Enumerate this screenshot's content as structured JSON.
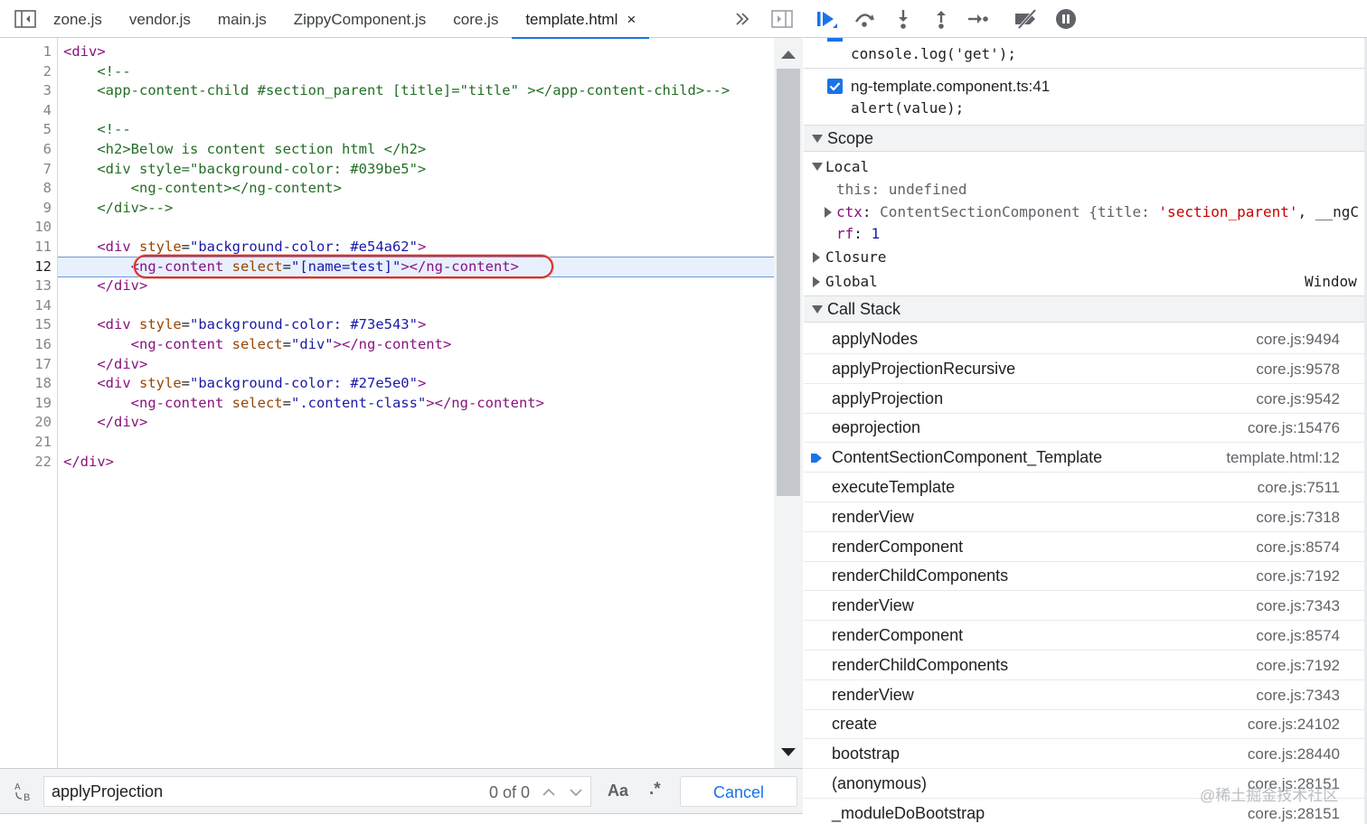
{
  "editor": {
    "tabs": [
      {
        "label": "zone.js"
      },
      {
        "label": "vendor.js"
      },
      {
        "label": "main.js"
      },
      {
        "label": "ZippyComponent.js"
      },
      {
        "label": "core.js"
      },
      {
        "label": "template.html",
        "active": true,
        "close": "×"
      }
    ],
    "overflow_icon": "chevron-double-right-icon",
    "current_line": 12,
    "lines": [
      {
        "n": "1",
        "tokens": [
          {
            "t": "<div>",
            "c": "tag"
          }
        ]
      },
      {
        "n": "2",
        "tokens": [
          {
            "t": "    <!--",
            "c": "cmt"
          }
        ]
      },
      {
        "n": "3",
        "tokens": [
          {
            "t": "    <app-content-child #section_parent [title]=\"title\" ></app-content-child>-->",
            "c": "cmt"
          }
        ]
      },
      {
        "n": "4",
        "tokens": []
      },
      {
        "n": "5",
        "tokens": [
          {
            "t": "    <!--",
            "c": "cmt"
          }
        ]
      },
      {
        "n": "6",
        "tokens": [
          {
            "t": "    <h2>Below is content section html </h2>",
            "c": "cmt"
          }
        ]
      },
      {
        "n": "7",
        "tokens": [
          {
            "t": "    <div style=\"background-color: #039be5\">",
            "c": "cmt"
          }
        ]
      },
      {
        "n": "8",
        "tokens": [
          {
            "t": "        <ng-content></ng-content>",
            "c": "cmt"
          }
        ]
      },
      {
        "n": "9",
        "tokens": [
          {
            "t": "    </div>-->",
            "c": "cmt"
          }
        ]
      },
      {
        "n": "10",
        "tokens": []
      },
      {
        "n": "11",
        "tokens": [
          {
            "t": "    <div ",
            "c": "tag"
          },
          {
            "t": "style",
            "c": "attr"
          },
          {
            "t": "=",
            "c": "plain"
          },
          {
            "t": "\"background-color: #e54a62\"",
            "c": "val"
          },
          {
            "t": ">",
            "c": "tag"
          }
        ]
      },
      {
        "n": "12",
        "tokens": [
          {
            "t": "        <ng-content ",
            "c": "tag"
          },
          {
            "t": "select",
            "c": "attr"
          },
          {
            "t": "=",
            "c": "plain"
          },
          {
            "t": "\"[name=test]\"",
            "c": "val"
          },
          {
            "t": "></ng-content>",
            "c": "tag"
          }
        ]
      },
      {
        "n": "13",
        "tokens": [
          {
            "t": "    </div>",
            "c": "tag"
          }
        ]
      },
      {
        "n": "14",
        "tokens": []
      },
      {
        "n": "15",
        "tokens": [
          {
            "t": "    <div ",
            "c": "tag"
          },
          {
            "t": "style",
            "c": "attr"
          },
          {
            "t": "=",
            "c": "plain"
          },
          {
            "t": "\"background-color: #73e543\"",
            "c": "val"
          },
          {
            "t": ">",
            "c": "tag"
          }
        ]
      },
      {
        "n": "16",
        "tokens": [
          {
            "t": "        <ng-content ",
            "c": "tag"
          },
          {
            "t": "select",
            "c": "attr"
          },
          {
            "t": "=",
            "c": "plain"
          },
          {
            "t": "\"div\"",
            "c": "val"
          },
          {
            "t": "></ng-content>",
            "c": "tag"
          }
        ]
      },
      {
        "n": "17",
        "tokens": [
          {
            "t": "    </div>",
            "c": "tag"
          }
        ]
      },
      {
        "n": "18",
        "tokens": [
          {
            "t": "    <div ",
            "c": "tag"
          },
          {
            "t": "style",
            "c": "attr"
          },
          {
            "t": "=",
            "c": "plain"
          },
          {
            "t": "\"background-color: #27e5e0\"",
            "c": "val"
          },
          {
            "t": ">",
            "c": "tag"
          }
        ]
      },
      {
        "n": "19",
        "tokens": [
          {
            "t": "        <ng-content ",
            "c": "tag"
          },
          {
            "t": "select",
            "c": "attr"
          },
          {
            "t": "=",
            "c": "plain"
          },
          {
            "t": "\".content-class\"",
            "c": "val"
          },
          {
            "t": "></ng-content>",
            "c": "tag"
          }
        ]
      },
      {
        "n": "20",
        "tokens": [
          {
            "t": "    </div>",
            "c": "tag"
          }
        ]
      },
      {
        "n": "21",
        "tokens": []
      },
      {
        "n": "22",
        "tokens": [
          {
            "t": "</div>",
            "c": "tag"
          }
        ]
      }
    ]
  },
  "search": {
    "value": "applyProjection",
    "count": "0 of 0",
    "match_case_label": "Aa",
    "regex_label": ".*",
    "cancel_label": "Cancel"
  },
  "breakpoints": {
    "partial_line": "console.log('get');",
    "items": [
      {
        "file": "ng-template.component.ts:41",
        "code": "alert(value);",
        "checked": true
      }
    ]
  },
  "scope": {
    "title": "Scope",
    "local_label": "Local",
    "this_key": "this",
    "this_value": "undefined",
    "ctx_key": "ctx",
    "ctx_value_prefix": "ContentSectionComponent {title: ",
    "ctx_value_str": "'section_parent'",
    "ctx_value_suffix": ", __ngC",
    "rf_key": "rf",
    "rf_value": "1",
    "closure_label": "Closure",
    "global_label": "Global",
    "global_value": "Window"
  },
  "call_stack": {
    "title": "Call Stack",
    "frames": [
      {
        "fn": "applyNodes",
        "loc": "core.js:9494"
      },
      {
        "fn": "applyProjectionRecursive",
        "loc": "core.js:9578"
      },
      {
        "fn": "applyProjection",
        "loc": "core.js:9542"
      },
      {
        "fn": "ɵɵprojection",
        "loc": "core.js:15476"
      },
      {
        "fn": "ContentSectionComponent_Template",
        "loc": "template.html:12",
        "current": true
      },
      {
        "fn": "executeTemplate",
        "loc": "core.js:7511"
      },
      {
        "fn": "renderView",
        "loc": "core.js:7318"
      },
      {
        "fn": "renderComponent",
        "loc": "core.js:8574"
      },
      {
        "fn": "renderChildComponents",
        "loc": "core.js:7192"
      },
      {
        "fn": "renderView",
        "loc": "core.js:7343"
      },
      {
        "fn": "renderComponent",
        "loc": "core.js:8574"
      },
      {
        "fn": "renderChildComponents",
        "loc": "core.js:7192"
      },
      {
        "fn": "renderView",
        "loc": "core.js:7343"
      },
      {
        "fn": "create",
        "loc": "core.js:24102"
      },
      {
        "fn": "bootstrap",
        "loc": "core.js:28440"
      },
      {
        "fn": "(anonymous)",
        "loc": "core.js:28151"
      },
      {
        "fn": "_moduleDoBootstrap",
        "loc": "core.js:28151"
      }
    ]
  },
  "watermark": "@稀土掘金技术社区",
  "colors": {
    "accent": "#1a73e8",
    "highlight_oval": "#d93025",
    "current_line_bg": "#e8f0fe"
  }
}
